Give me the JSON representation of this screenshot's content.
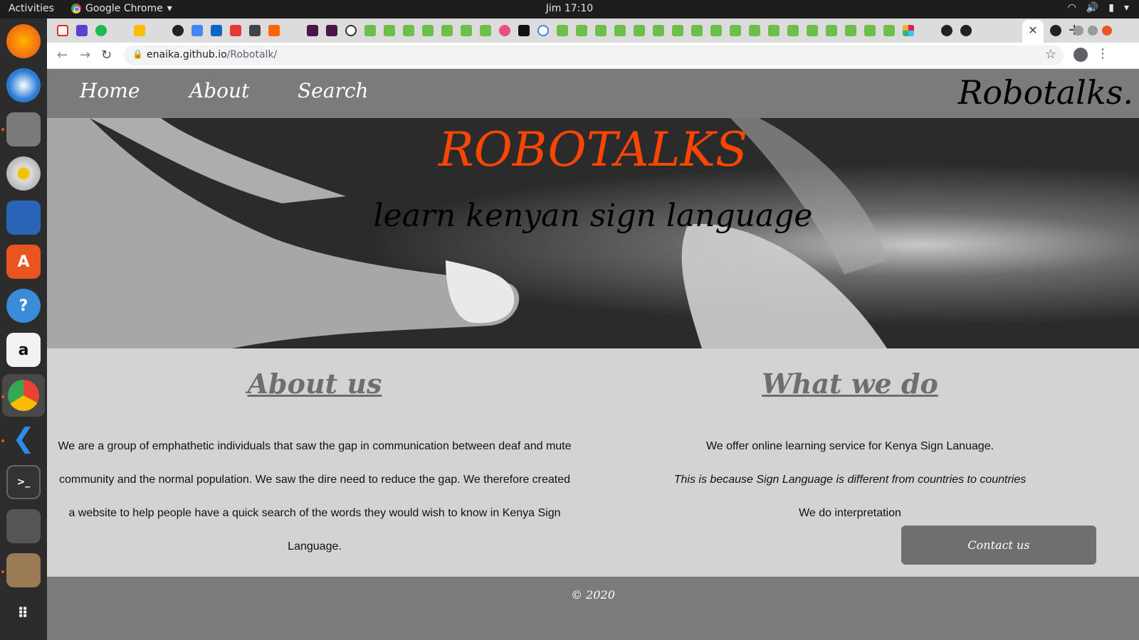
{
  "os": {
    "activities": "Activities",
    "app_name": "Google Chrome",
    "clock": "Jim 17:10"
  },
  "browser": {
    "url_host": "enaika.github.io",
    "url_path": "/Robotalk/",
    "active_tab_close": "✕",
    "new_tab": "+"
  },
  "site": {
    "nav": {
      "home": "Home",
      "about": "About",
      "search": "Search"
    },
    "brand": "Robotalks.",
    "hero": {
      "title": "ROBOTALKS",
      "subtitle": "learn kenyan sign language"
    },
    "about": {
      "heading": "About us",
      "lines": [
        "We are a group of emphathetic individuals that saw the gap in communication between deaf and mute",
        "community and the normal population. We saw the dire need to reduce the gap. We therefore created",
        "a website to help people have a quick search of the words they would wish to know in Kenya Sign",
        "Language."
      ]
    },
    "what": {
      "heading": "What we do",
      "line1": "We offer online learning service for Kenya Sign Lanuage.",
      "line2": "This is because Sign Language is different from countries to countries",
      "line3": "We do interpretation"
    },
    "contact_button": "Contact us",
    "footer": "© 2020"
  }
}
